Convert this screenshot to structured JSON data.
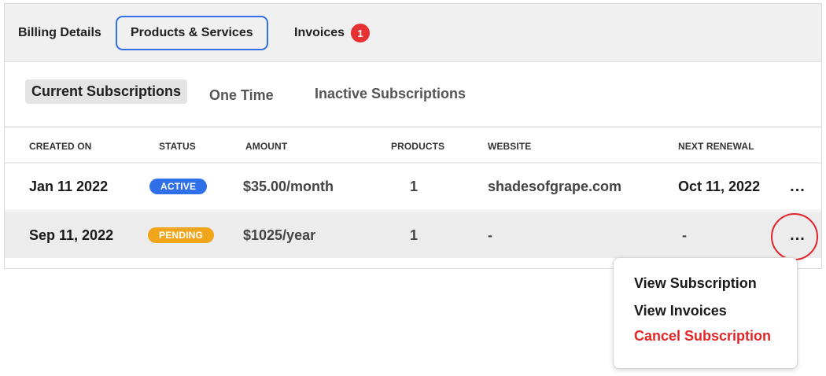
{
  "top_tabs": {
    "billing": "Billing Details",
    "products": "Products & Services",
    "invoices": "Invoices",
    "invoices_badge": "1"
  },
  "sub_tabs": {
    "current": "Current Subscriptions",
    "one_time": "One Time",
    "inactive": "Inactive Subscriptions"
  },
  "table": {
    "headers": {
      "created_on": "CREATED ON",
      "status": "STATUS",
      "amount": "AMOUNT",
      "products": "PRODUCTS",
      "website": "WEBSITE",
      "next_renewal": "NEXT RENEWAL"
    },
    "rows": [
      {
        "created_on": "Jan 11 2022",
        "status": "ACTIVE",
        "amount": "$35.00/month",
        "products": "1",
        "website": "shadesofgrape.com",
        "next_renewal": "Oct 11, 2022",
        "menu": "..."
      },
      {
        "created_on": "Sep 11, 2022",
        "status": "PENDING",
        "amount": "$1025/year",
        "products": "1",
        "website": "-",
        "next_renewal": "-",
        "menu": "..."
      }
    ]
  },
  "dropdown": {
    "view_subscription": "View Subscription",
    "view_invoices": "View Invoices",
    "cancel_subscription": "Cancel Subscription"
  },
  "colors": {
    "accent": "#2f6fe8",
    "danger": "#e32626",
    "pending": "#f0a51a"
  }
}
